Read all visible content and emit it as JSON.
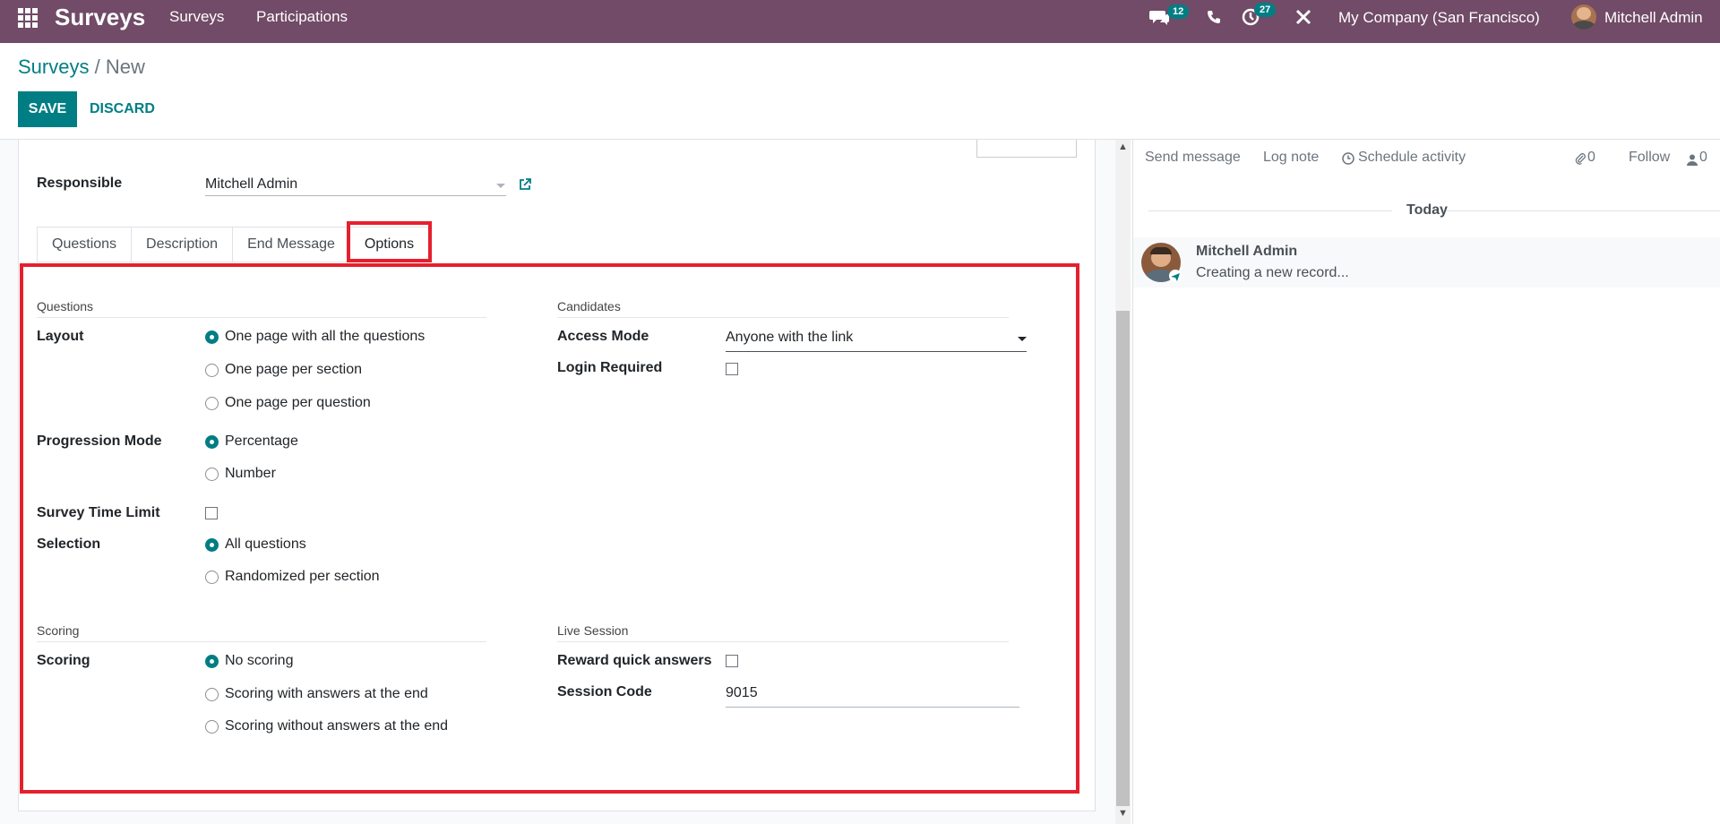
{
  "navbar": {
    "app_name": "Surveys",
    "menu": [
      "Surveys",
      "Participations"
    ],
    "messages_count": "12",
    "activities_count": "27",
    "company": "My Company (San Francisco)",
    "user": "Mitchell Admin"
  },
  "breadcrumb": {
    "parent": "Surveys",
    "separator": "/",
    "current": "New"
  },
  "buttons": {
    "save": "SAVE",
    "discard": "DISCARD"
  },
  "form": {
    "responsible_label": "Responsible",
    "responsible_value": "Mitchell Admin",
    "tabs": [
      "Questions",
      "Description",
      "End Message",
      "Options"
    ],
    "active_tab": "Options",
    "questions_section": "Questions",
    "layout_label": "Layout",
    "layout_options": [
      "One page with all the questions",
      "One page per section",
      "One page per question"
    ],
    "progression_label": "Progression Mode",
    "progression_options": [
      "Percentage",
      "Number"
    ],
    "time_limit_label": "Survey Time Limit",
    "selection_label": "Selection",
    "selection_options": [
      "All questions",
      "Randomized per section"
    ],
    "candidates_section": "Candidates",
    "access_mode_label": "Access Mode",
    "access_mode_value": "Anyone with the link",
    "login_required_label": "Login Required",
    "scoring_section": "Scoring",
    "scoring_label": "Scoring",
    "scoring_options": [
      "No scoring",
      "Scoring with answers at the end",
      "Scoring without answers at the end"
    ],
    "live_session_section": "Live Session",
    "reward_label": "Reward quick answers",
    "session_code_label": "Session Code",
    "session_code_value": "9015"
  },
  "chatter": {
    "send_message": "Send message",
    "log_note": "Log note",
    "schedule_activity": "Schedule activity",
    "attachments_count": "0",
    "follow": "Follow",
    "followers_count": "0",
    "today": "Today",
    "author": "Mitchell Admin",
    "message": "Creating a new record..."
  },
  "colors": {
    "navbar": "#714B67",
    "primary": "#017e84",
    "highlight": "#e5202e"
  }
}
